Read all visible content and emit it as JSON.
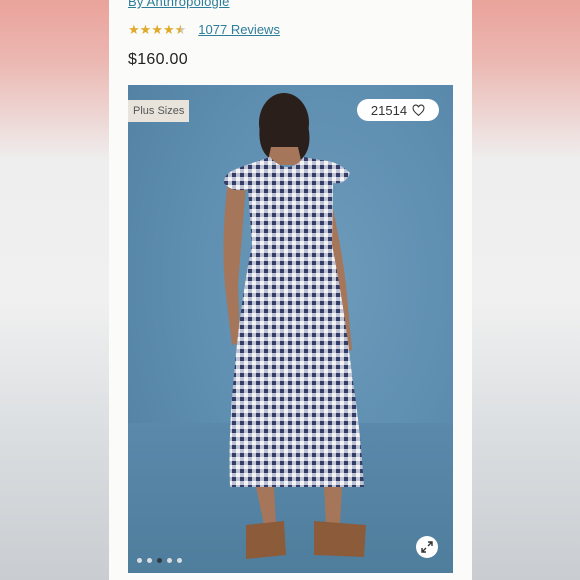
{
  "product": {
    "brand": "By Anthropologie",
    "rating_stars": 4.5,
    "reviews": "1077 Reviews",
    "price": "$160.00"
  },
  "gallery": {
    "badge": "Plus Sizes",
    "likes": "21514",
    "dot_count": 5,
    "active_dot": 2,
    "icons": [
      "heart-icon",
      "expand-icon"
    ]
  },
  "colors": {
    "link": "#2d7d9a",
    "star": "#e0a92a",
    "photo_bg": "#5f8fb1"
  }
}
